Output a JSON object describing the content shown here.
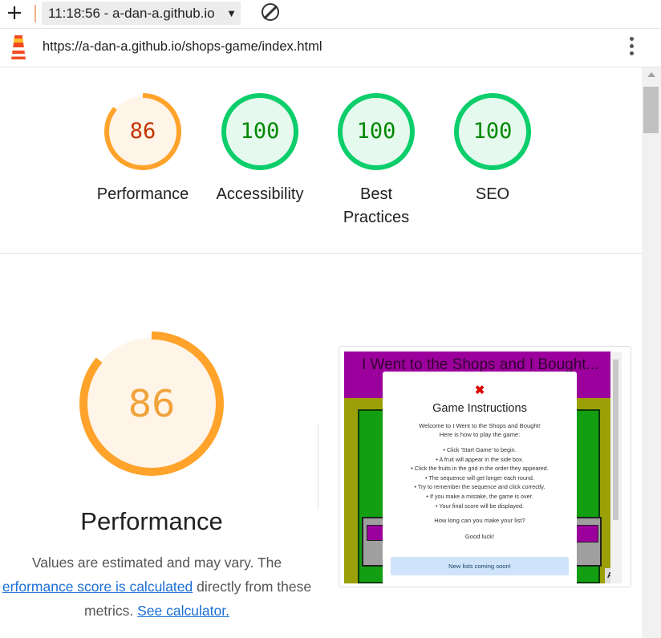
{
  "browser": {
    "timestamp_select": "11:18:56 - a-dan-a.github.io",
    "url": "https://a-dan-a.github.io/shops-game/index.html"
  },
  "gauges": [
    {
      "label": "Performance",
      "score": "86",
      "value": 0.86,
      "status": "average"
    },
    {
      "label": "Accessibility",
      "score": "100",
      "value": 1.0,
      "status": "pass"
    },
    {
      "label_lines": [
        "Best",
        "Practices"
      ],
      "score": "100",
      "value": 1.0,
      "status": "pass"
    },
    {
      "label": "SEO",
      "score": "100",
      "value": 1.0,
      "status": "pass"
    }
  ],
  "performance": {
    "score": "86",
    "value": 0.86,
    "title": "Performance",
    "desc_prefix": "Values are estimated and may vary. The",
    "link_score_calc": "erformance score is calculated",
    "desc_middle": " directly from these",
    "desc_metrics": "metrics. ",
    "link_calculator": "See calculator."
  },
  "screenshot": {
    "game_title": "I Went to the Shops and I Bought...",
    "modal": {
      "close": "✖",
      "heading": "Game Instructions",
      "intro_1": "Welcome to I Went to the Shops and Bought!",
      "intro_2": "Here is how to play the game:",
      "steps": [
        "Click 'Start Game' to begin.",
        "A fruit will appear in the side box.",
        "Click the fruits in the grid in the order they appeared.",
        "The sequence will get longer each round.",
        "Try to remember the sequence and click correctly.",
        "If you make a mistake, the game is over.",
        "Your final score will be displayed."
      ],
      "question": "How long can you make your list?",
      "good_luck": "Good luck!",
      "notice": "New lists coming soon!"
    },
    "corner_letter": "A"
  },
  "colors": {
    "average": "#ffa32b",
    "average_bg": "#fff4e8",
    "average_text": "#c33300",
    "pass": "#0cce6b",
    "pass_bg": "#e6f9ee",
    "pass_text": "#008800"
  },
  "icons": [
    "plus-icon",
    "dropdown-caret-icon",
    "block-icon",
    "lighthouse-icon",
    "kebab-menu-icon",
    "scroll-up-icon"
  ]
}
